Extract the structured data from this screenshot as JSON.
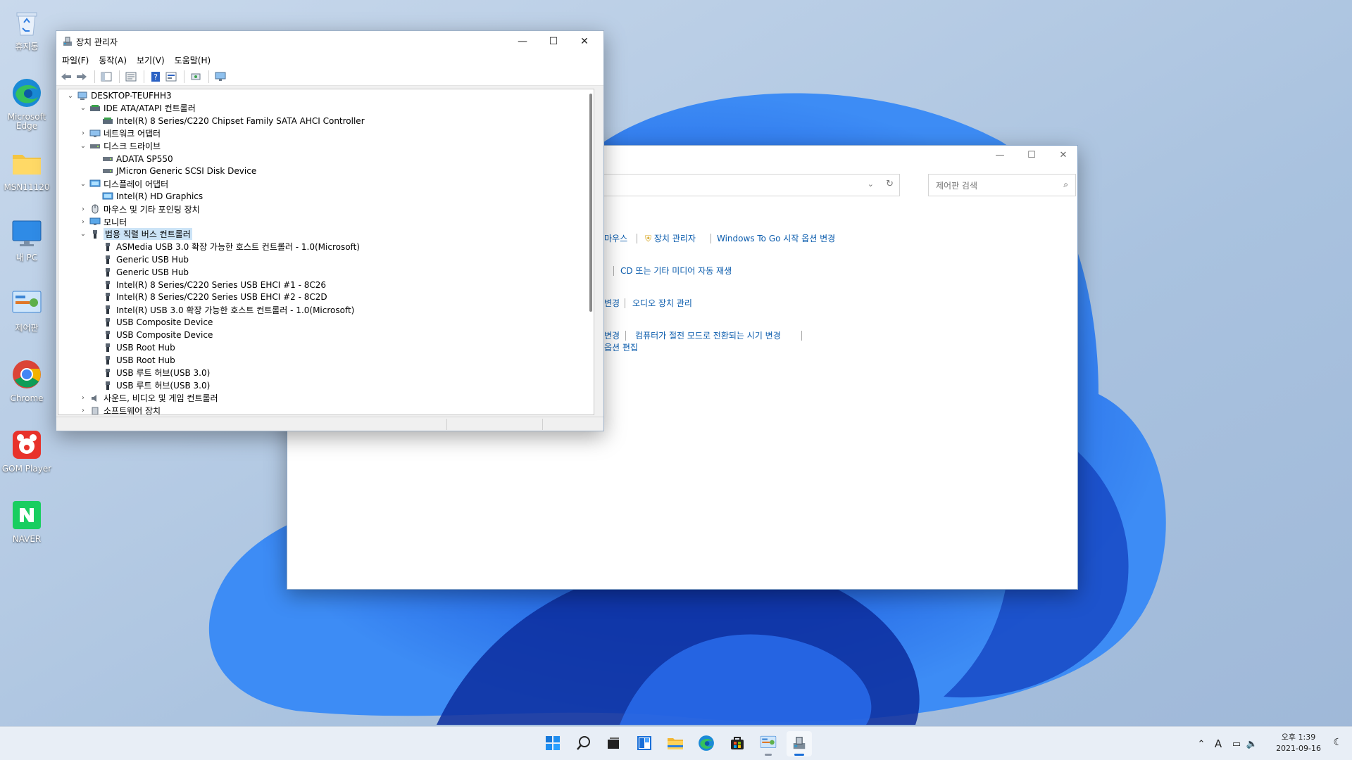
{
  "desktop": {
    "icons": [
      {
        "label": "휴지통",
        "icon": "recycle-bin-icon"
      },
      {
        "label": "Microsoft Edge",
        "icon": "edge-icon"
      },
      {
        "label": "MSN11120",
        "icon": "folder-icon"
      },
      {
        "label": "내 PC",
        "icon": "monitor-icon"
      },
      {
        "label": "제어판",
        "icon": "control-panel-icon"
      },
      {
        "label": "Chrome",
        "icon": "chrome-icon"
      },
      {
        "label": "GOM Player",
        "icon": "gom-player-icon"
      },
      {
        "label": "NAVER",
        "icon": "naver-icon"
      }
    ]
  },
  "control_panel": {
    "search_placeholder": "제어판 검색",
    "links": {
      "mouse": "마우스",
      "device_manager": "장치 관리자",
      "windows_to_go": "Windows To Go 시작 옵션 변경",
      "autoplay": "CD 또는 기타 미디어 자동 재생",
      "change_partial": "변경",
      "audio": "오디오 장치 관리",
      "change_partial2": "변경",
      "sleep": "컴퓨터가 절전 모드로 전환되는 시기 변경",
      "edit_options_partial": "옵션 편집"
    }
  },
  "device_manager": {
    "title": "장치 관리자",
    "menu": [
      "파일(F)",
      "동작(A)",
      "보기(V)",
      "도움말(H)"
    ],
    "tree": [
      {
        "label": "DESKTOP-TEUFHH3",
        "icon": "computer-icon",
        "chev": "v"
      },
      {
        "label": "IDE ATA/ATAPI 컨트롤러",
        "icon": "ide-controller-icon",
        "chev": "v"
      },
      {
        "label": "Intel(R) 8 Series/C220 Chipset Family SATA AHCI Controller",
        "icon": "ide-controller-icon",
        "chev": ""
      },
      {
        "label": "네트워크 어댑터",
        "icon": "network-adapter-icon",
        "chev": ">"
      },
      {
        "label": "디스크 드라이브",
        "icon": "disk-drive-icon",
        "chev": "v"
      },
      {
        "label": "ADATA SP550",
        "icon": "disk-drive-icon",
        "chev": ""
      },
      {
        "label": "JMicron Generic SCSI Disk Device",
        "icon": "disk-drive-icon",
        "chev": ""
      },
      {
        "label": "디스플레이 어댑터",
        "icon": "display-adapter-icon",
        "chev": "v"
      },
      {
        "label": "Intel(R) HD Graphics",
        "icon": "display-adapter-icon",
        "chev": ""
      },
      {
        "label": "마우스 및 기타 포인팅 장치",
        "icon": "mouse-icon",
        "chev": ">"
      },
      {
        "label": "모니터",
        "icon": "monitor-icon",
        "chev": ">"
      },
      {
        "label": "범용 직렬 버스 컨트롤러",
        "icon": "usb-icon",
        "chev": "v"
      },
      {
        "label": "ASMedia USB 3.0 확장 가능한 호스트 컨트롤러 - 1.0(Microsoft)",
        "icon": "usb-icon",
        "chev": ""
      },
      {
        "label": "Generic USB Hub",
        "icon": "usb-icon",
        "chev": ""
      },
      {
        "label": "Generic USB Hub",
        "icon": "usb-icon",
        "chev": ""
      },
      {
        "label": "Intel(R) 8 Series/C220 Series USB EHCI #1 - 8C26",
        "icon": "usb-icon",
        "chev": ""
      },
      {
        "label": "Intel(R) 8 Series/C220 Series USB EHCI #2 - 8C2D",
        "icon": "usb-icon",
        "chev": ""
      },
      {
        "label": "Intel(R) USB 3.0 확장 가능한 호스트 컨트롤러 - 1.0(Microsoft)",
        "icon": "usb-icon",
        "chev": ""
      },
      {
        "label": "USB Composite Device",
        "icon": "usb-icon",
        "chev": ""
      },
      {
        "label": "USB Composite Device",
        "icon": "usb-icon",
        "chev": ""
      },
      {
        "label": "USB Root Hub",
        "icon": "usb-icon",
        "chev": ""
      },
      {
        "label": "USB Root Hub",
        "icon": "usb-icon",
        "chev": ""
      },
      {
        "label": "USB 루트 허브(USB 3.0)",
        "icon": "usb-icon",
        "chev": ""
      },
      {
        "label": "USB 루트 허브(USB 3.0)",
        "icon": "usb-icon",
        "chev": ""
      },
      {
        "label": "사운드, 비디오 및 게임 컨트롤러",
        "icon": "sound-icon",
        "chev": ">"
      },
      {
        "label": "소프트웨어 장치",
        "icon": "software-device-icon",
        "chev": ">"
      }
    ],
    "selected_item": "범용 직렬 버스 컨트롤러"
  },
  "taskbar": {
    "apps": [
      "start-icon",
      "search-icon",
      "task-view-icon",
      "widgets-icon",
      "file-explorer-icon",
      "edge-icon",
      "store-icon",
      "control-panel-icon",
      "device-manager-icon"
    ],
    "tray": {
      "input_indicator": "A"
    },
    "clock": {
      "time": "오후 1:39",
      "date": "2021-09-16"
    }
  }
}
